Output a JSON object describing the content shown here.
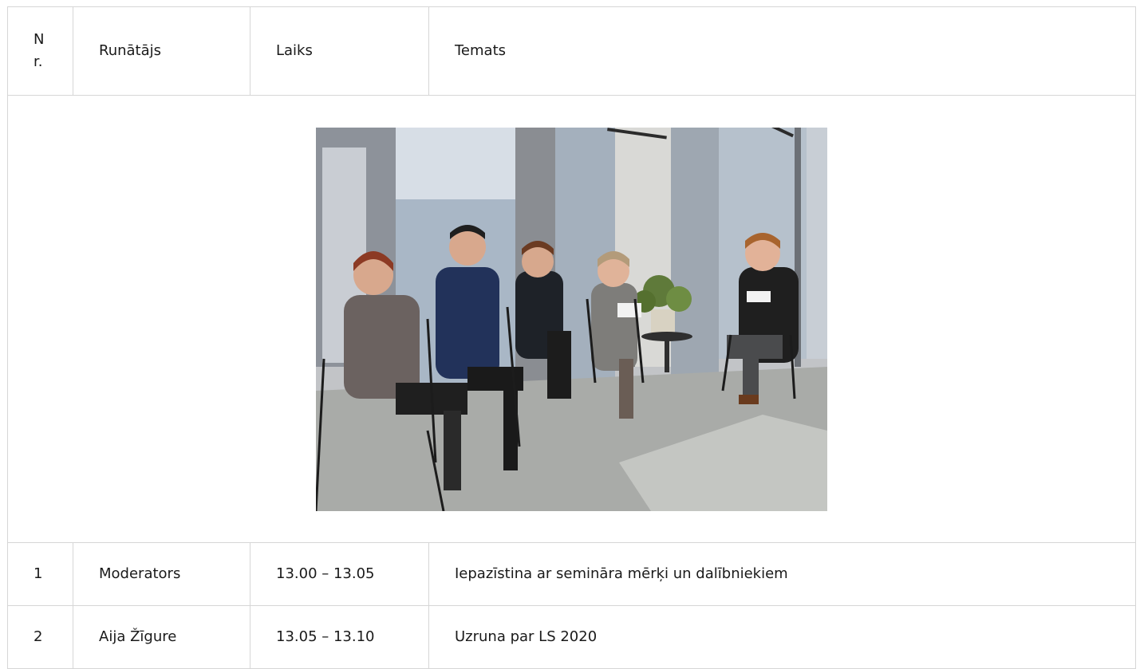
{
  "table": {
    "headers": {
      "nr": "Nr.",
      "speaker": "Runātājs",
      "time": "Laiks",
      "topic": "Temats"
    },
    "photo": {
      "icon": "seminar-photo-icon"
    },
    "rows": [
      {
        "nr": "1",
        "speaker": "Moderators",
        "time": "13.00 – 13.05",
        "topic": "Iepazīstina ar semināra mērķi un dalībniekiem"
      },
      {
        "nr": "2",
        "speaker": "Aija Žīgure",
        "time": "13.05 – 13.10",
        "topic": "Uzruna par LS 2020"
      }
    ]
  },
  "colors": {
    "border": "#d6d6d6",
    "text": "#1a1a1a",
    "background": "#ffffff"
  }
}
